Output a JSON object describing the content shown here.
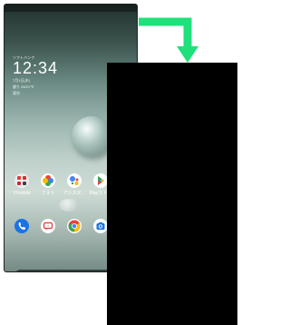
{
  "status": {
    "carrier": "ソフトバンク",
    "date": "7月1日(木)",
    "weather": "曇り 26/21℃",
    "area": "東京"
  },
  "clock": {
    "time": "12:34"
  },
  "apps_row": [
    {
      "label": "Y!mobile",
      "icon": "folder-icon"
    },
    {
      "label": "フォト",
      "icon": "photos-icon"
    },
    {
      "label": "アシスタ…",
      "icon": "assistant-icon"
    },
    {
      "label": "Playストア",
      "icon": "play-store-icon"
    }
  ],
  "dock": [
    {
      "icon": "phone-icon"
    },
    {
      "icon": "messages-icon"
    },
    {
      "icon": "chrome-icon"
    },
    {
      "icon": "camera-icon"
    }
  ],
  "search": {
    "icon": "google-icon",
    "glyph": "G"
  },
  "colors": {
    "arrow": "#1fe07a",
    "panel": "#000000",
    "phone_icon": "#1a73e8"
  }
}
